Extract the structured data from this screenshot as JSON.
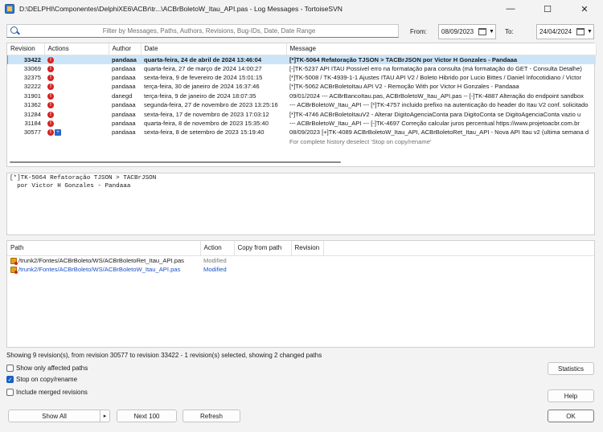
{
  "window": {
    "title": "D:\\DELPHI\\Componentes\\DelphiXE6\\ACBr\\tr...\\ACBrBoletoW_Itau_API.pas - Log Messages - TortoiseSVN",
    "minimize": "—",
    "maximize": "☐",
    "close": "✕"
  },
  "filter": {
    "placeholder": "Filter by Messages, Paths, Authors, Revisions, Bug-IDs, Date, Date Range",
    "from_label": "From:",
    "from_value": "08/09/2023",
    "to_label": "To:",
    "to_value": "24/04/2024"
  },
  "log": {
    "columns": [
      "Revision",
      "Actions",
      "Author",
      "Date",
      "Message"
    ],
    "rows": [
      {
        "rev": "33422",
        "author": "pandaaa",
        "date": "quarta-feira, 24 de abril de 2024 13:46:04",
        "msg": "[*]TK-5064 Refatoração TJSON > TACBrJSON   por Victor H Gonzales - Pandaaa"
      },
      {
        "rev": "33069",
        "author": "pandaaa",
        "date": "quarta-feira, 27 de março de 2024 14:00:27",
        "msg": "[-]TK-5237 API ITAU Possivel erro na formatação para consulta (má formatação do GET - Consulta Detalhe)"
      },
      {
        "rev": "32375",
        "author": "pandaaa",
        "date": "sexta-feira, 9 de fevereiro de 2024 15:01:15",
        "msg": "[*]TK-5008 / TK-4939-1-1 Ajustes ITAU API V2 / Boleto Hibrido   por Lucio Bittes / Daniel Infocotidiano / Victor"
      },
      {
        "rev": "32222",
        "author": "pandaaa",
        "date": "terça-feira, 30 de janeiro de 2024 16:37:46",
        "msg": "[*]TK-5062 ACBrBoletoItau API V2 - Remoção With   por Victor H Gonzales - Pandaaa"
      },
      {
        "rev": "31901",
        "author": "danegd",
        "date": "terça-feira, 9 de janeiro de 2024 18:07:35",
        "msg": "09/01/2024 --- ACBrBancoItau.pas, ACBrBoletoW_Itau_API.pas -- [-]TK-4887 Alteração do endpoint sandbox"
      },
      {
        "rev": "31362",
        "author": "pandaaa",
        "date": "segunda-feira, 27 de novembro de 2023 13:25:16",
        "msg": "--- ACBrBoletoW_Itau_API --- [*]TK-4757 incluido prefixo na autenticação do header do Itau V2 conf. solicitado"
      },
      {
        "rev": "31284",
        "author": "pandaaa",
        "date": "sexta-feira, 17 de novembro de 2023 17:03:12",
        "msg": "[*]TK-4746 ACBrBoletoItauV2 - Alterar DigitoAgenciaConta para DigitoConta se DigitoAgenciaConta vazio u"
      },
      {
        "rev": "31184",
        "author": "pandaaa",
        "date": "quarta-feira, 8 de novembro de 2023 15:35:40",
        "msg": "--- ACBrBoletoW_Itau_API --- [-]TK-4697 Correção calcular juros percentual https://www.projetoacbr.com.br"
      },
      {
        "rev": "30577",
        "author": "pandaaa",
        "date": "sexta-feira, 8 de setembro de 2023 15:19:40",
        "msg": "08/09/2023 [+]TK-4089 ACBrBoletoW_Itau_API, ACBrBoletoRet_Itau_API - Nova API Itau v2 (ultima semana d"
      }
    ],
    "note": "For complete history deselect 'Stop on copy/rename'"
  },
  "message_text": "[*]TK-5064 Refatoração TJSON > TACBrJSON\n  por Victor H Gonzales - Pandaaa",
  "paths": {
    "columns": [
      "Path",
      "Action",
      "Copy from path",
      "Revision"
    ],
    "rows": [
      {
        "path": "/trunk2/Fontes/ACBrBoleto/WS/ACBrBoletoRet_Itau_API.pas",
        "action": "Modified"
      },
      {
        "path": "/trunk2/Fontes/ACBrBoleto/WS/ACBrBoletoW_Itau_API.pas",
        "action": "Modified"
      }
    ]
  },
  "status": "Showing 9 revision(s), from revision 30577 to revision 33422 - 1 revision(s) selected, showing 2 changed paths",
  "options": {
    "show_affected": "Show only affected paths",
    "stop_on_copy": "Stop on copy/rename",
    "include_merged": "Include merged revisions"
  },
  "buttons": {
    "show_all": "Show All",
    "next_100": "Next 100",
    "refresh": "Refresh",
    "statistics": "Statistics",
    "help": "Help",
    "ok": "OK"
  }
}
